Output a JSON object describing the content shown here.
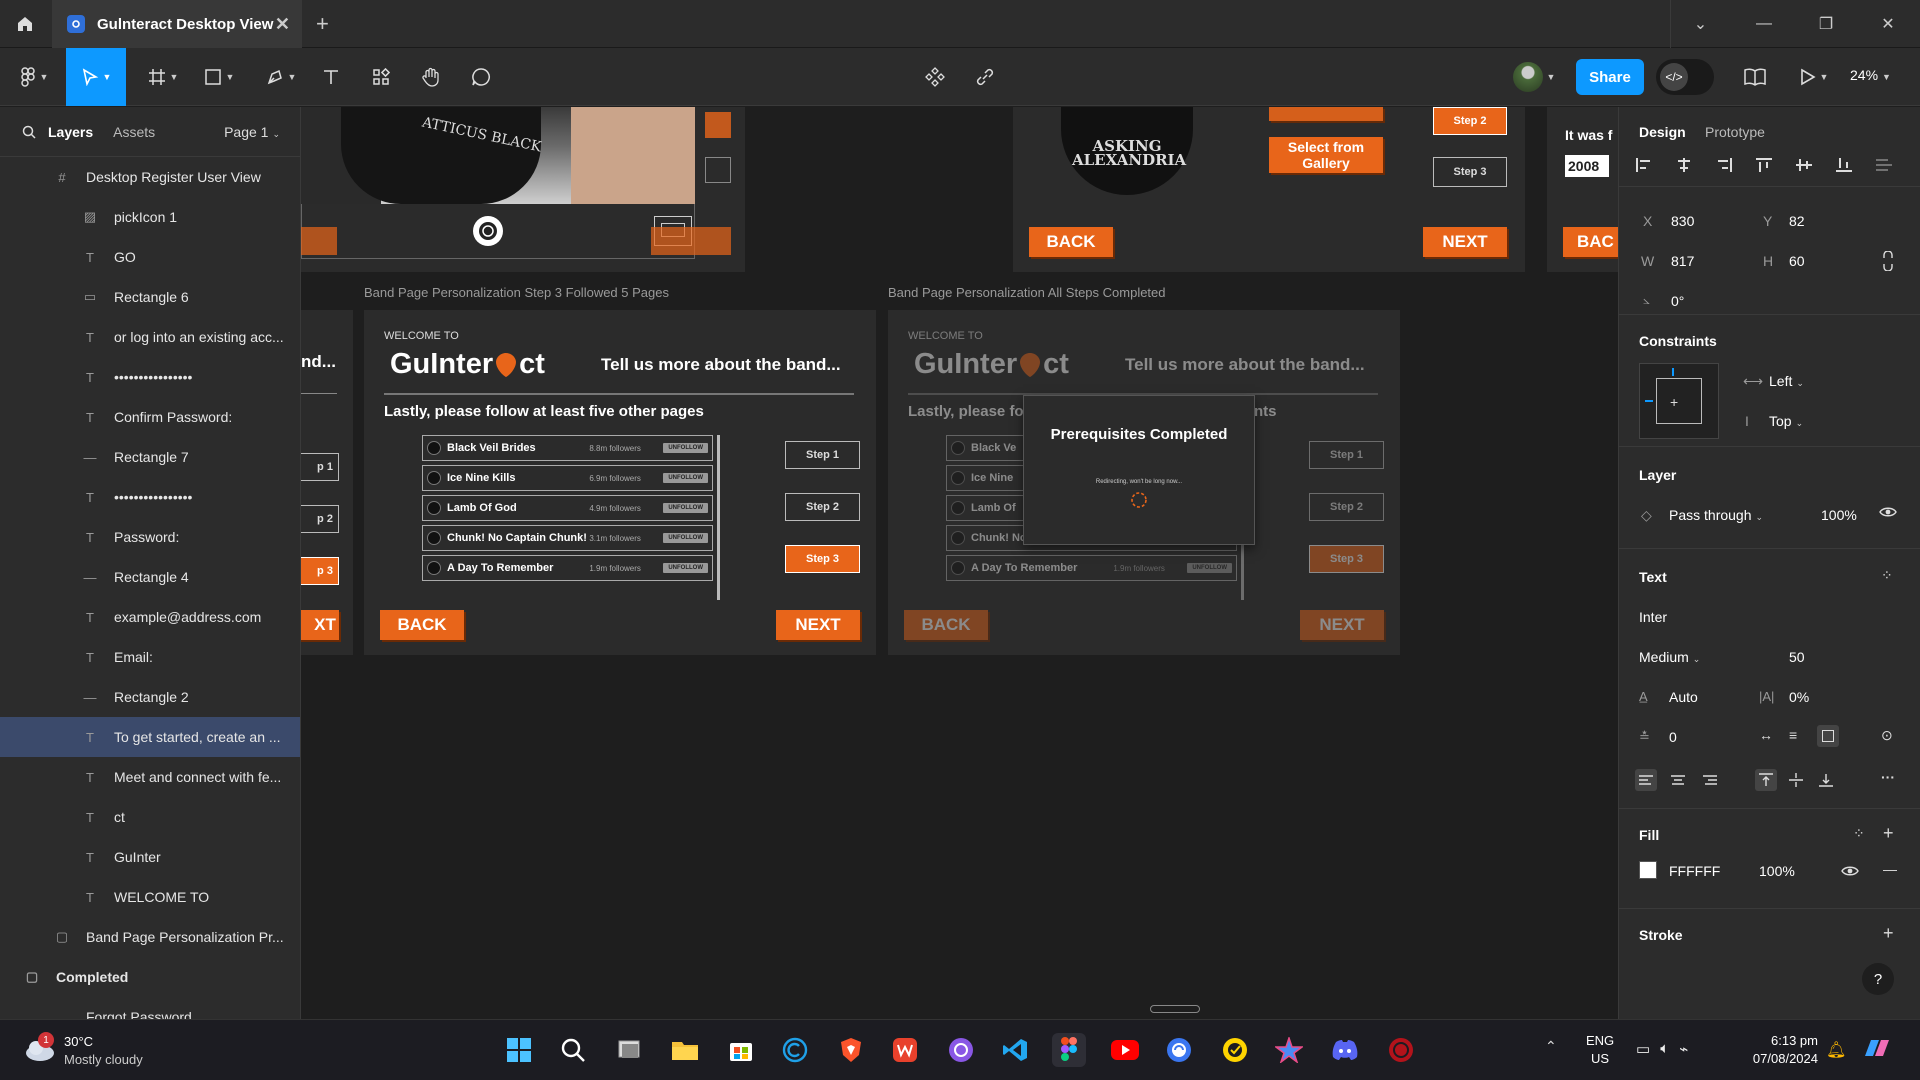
{
  "titlebar": {
    "tab_title": "Gulnteract Desktop View",
    "close": "✕",
    "new_tab": "+"
  },
  "toolbar": {
    "share_label": "Share",
    "zoom_label": "24%"
  },
  "left_panel": {
    "tabs": {
      "layers": "Layers",
      "assets": "Assets",
      "page": "Page 1"
    },
    "layers": [
      {
        "label": "Desktop Register User View",
        "icon": "#",
        "indent": 1
      },
      {
        "label": "pickIcon 1",
        "icon": "▨",
        "indent": 2
      },
      {
        "label": "GO",
        "icon": "T",
        "indent": 2
      },
      {
        "label": "Rectangle 6",
        "icon": "▭",
        "indent": 2
      },
      {
        "label": "or log into an existing acc...",
        "icon": "T",
        "indent": 2
      },
      {
        "label": "••••••••••••••••",
        "icon": "T",
        "indent": 2
      },
      {
        "label": "Confirm Password:",
        "icon": "T",
        "indent": 2
      },
      {
        "label": "Rectangle 7",
        "icon": "—",
        "indent": 2
      },
      {
        "label": "••••••••••••••••",
        "icon": "T",
        "indent": 2
      },
      {
        "label": "Password:",
        "icon": "T",
        "indent": 2
      },
      {
        "label": "Rectangle 4",
        "icon": "—",
        "indent": 2
      },
      {
        "label": "example@address.com",
        "icon": "T",
        "indent": 2
      },
      {
        "label": "Email:",
        "icon": "T",
        "indent": 2
      },
      {
        "label": "Rectangle 2",
        "icon": "—",
        "indent": 2
      },
      {
        "label": "To get started, create an ...",
        "icon": "T",
        "indent": 2,
        "selected": true
      },
      {
        "label": "Meet and connect with fe...",
        "icon": "T",
        "indent": 2
      },
      {
        "label": "ct",
        "icon": "T",
        "indent": 2
      },
      {
        "label": "GuInter",
        "icon": "T",
        "indent": 2
      },
      {
        "label": "WELCOME TO",
        "icon": "T",
        "indent": 2
      },
      {
        "label": "Band Page Personalization Pr...",
        "icon": "▢",
        "indent": 1
      },
      {
        "label": "Completed",
        "icon": "▢",
        "indent": 0,
        "bold": true
      },
      {
        "label": "Forgot Password",
        "icon": "",
        "indent": 1
      }
    ]
  },
  "canvas": {
    "top_partial": {
      "band_logo": "ASKING ALEXANDRIA",
      "select_gallery": "Select from Gallery",
      "step2": "Step 2",
      "step3": "Step 3",
      "back": "BACK",
      "next": "NEXT",
      "it_was": "It was f",
      "year": "2008",
      "bac": "BAC",
      "shirt_text": "ATTICUS BLACK"
    },
    "left_partial": {
      "nd": "nd...",
      "p1": "p 1",
      "p2": "p 2",
      "p3": "p 3",
      "xt": "XT"
    },
    "frame_a": {
      "label": "Band Page Personalization Step 3 Followed 5 Pages",
      "welcome": "WELCOME TO",
      "logo_a": "GuInter",
      "logo_b": "ct",
      "tagline": "Tell us more about the band...",
      "instruction": "Lastly, please follow at least five other pages",
      "steps": [
        "Step 1",
        "Step 2",
        "Step 3"
      ],
      "back": "BACK",
      "next": "NEXT"
    },
    "frame_b": {
      "label": "Band Page Personalization All Steps Completed",
      "welcome": "WELCOME TO",
      "logo_a": "GuInter",
      "logo_b": "ct",
      "tagline": "Tell us more about the band...",
      "instruction_a": "Lastly, please fo",
      "instruction_b": "nts",
      "steps": [
        "Step 1",
        "Step 2",
        "Step 3"
      ],
      "back": "BACK",
      "next": "NEXT",
      "modal_title": "Prerequisites Completed",
      "modal_text": "Redirecting, won't be long now..."
    },
    "bands": [
      {
        "name": "Black Veil Brides",
        "followers": "8.8m followers",
        "button": "UNFOLLOW"
      },
      {
        "name": "Ice Nine Kills",
        "followers": "6.9m followers",
        "button": "UNFOLLOW"
      },
      {
        "name": "Lamb Of God",
        "followers": "4.9m followers",
        "button": "UNFOLLOW"
      },
      {
        "name": "Chunk! No Captain Chunk!",
        "followers": "3.1m followers",
        "button": "UNFOLLOW"
      },
      {
        "name": "A Day To Remember",
        "followers": "1.9m followers",
        "button": "UNFOLLOW"
      }
    ],
    "bands_b": [
      {
        "name": "Black Ve"
      },
      {
        "name": "Ice Nine"
      },
      {
        "name": "Lamb Of"
      },
      {
        "name": "Chunk! No"
      },
      {
        "name": "A Day To Remember",
        "followers": "1.9m followers",
        "button": "UNFOLLOW"
      }
    ]
  },
  "right_panel": {
    "tabs": {
      "design": "Design",
      "prototype": "Prototype"
    },
    "position": {
      "x_label": "X",
      "x": "830",
      "y_label": "Y",
      "y": "82",
      "w_label": "W",
      "w": "817",
      "h_label": "H",
      "h": "60",
      "rotation": "0°"
    },
    "constraints": {
      "title": "Constraints",
      "horizontal": "Left",
      "vertical": "Top"
    },
    "layer": {
      "title": "Layer",
      "blend": "Pass through",
      "opacity": "100%"
    },
    "text": {
      "title": "Text",
      "font": "Inter",
      "weight": "Medium",
      "size": "50",
      "line_height": "Auto",
      "letter_spacing": "0%",
      "paragraph_spacing": "0"
    },
    "fill": {
      "title": "Fill",
      "hex": "FFFFFF",
      "opacity": "100%",
      "color": "#ffffff"
    },
    "stroke": {
      "title": "Stroke"
    },
    "help": "?"
  },
  "taskbar": {
    "weather_temp": "30°C",
    "weather_desc": "Mostly cloudy",
    "weather_badge": "1",
    "lang_a": "ENG",
    "lang_b": "US",
    "time": "6:13 pm",
    "date": "07/08/2024"
  },
  "colors": {
    "accent": "#0d99ff",
    "orange": "#e8651a",
    "selection": "#3b4a6b"
  }
}
